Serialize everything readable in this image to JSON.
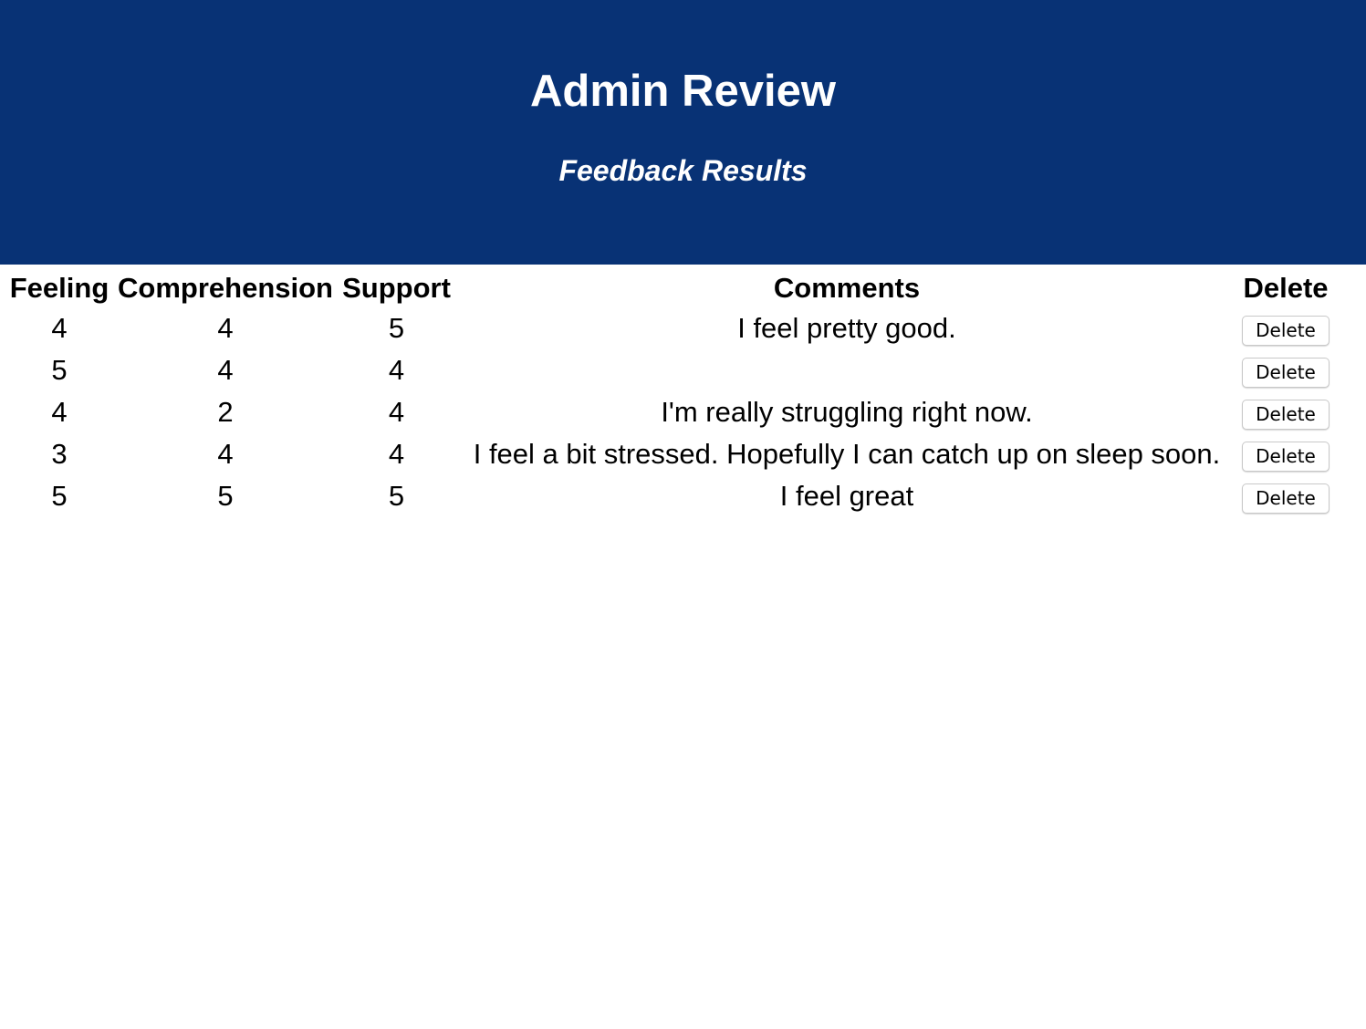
{
  "header": {
    "title": "Admin Review",
    "subtitle": "Feedback Results",
    "background_color": "#083275"
  },
  "table": {
    "columns": [
      "Feeling",
      "Comprehension",
      "Support",
      "Comments",
      "Delete"
    ],
    "rows": [
      {
        "feeling": "4",
        "comprehension": "4",
        "support": "5",
        "comments": "I feel pretty good.",
        "delete_label": "Delete"
      },
      {
        "feeling": "5",
        "comprehension": "4",
        "support": "4",
        "comments": "",
        "delete_label": "Delete"
      },
      {
        "feeling": "4",
        "comprehension": "2",
        "support": "4",
        "comments": "I'm really struggling right now.",
        "delete_label": "Delete"
      },
      {
        "feeling": "3",
        "comprehension": "4",
        "support": "4",
        "comments": "I feel a bit stressed. Hopefully I can catch up on sleep soon.",
        "delete_label": "Delete"
      },
      {
        "feeling": "5",
        "comprehension": "5",
        "support": "5",
        "comments": "I feel great",
        "delete_label": "Delete"
      }
    ]
  }
}
